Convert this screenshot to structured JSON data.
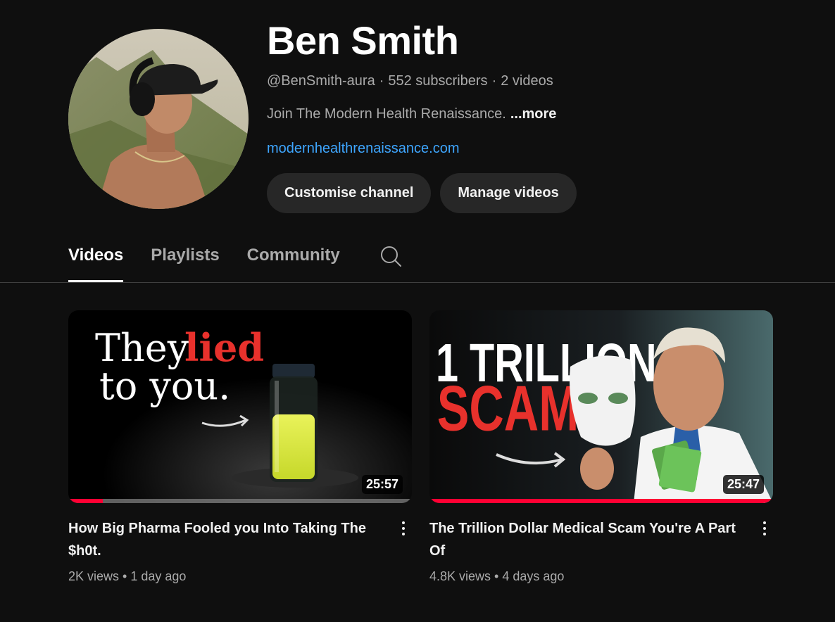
{
  "channel": {
    "name": "Ben Smith",
    "handle": "@BenSmith-aura",
    "subscribers": "552 subscribers",
    "video_count": "2 videos",
    "description": "Join The Modern Health Renaissance.",
    "more_label": "...more",
    "link": "modernhealthrenaissance.com",
    "buttons": {
      "customise": "Customise channel",
      "manage": "Manage videos"
    }
  },
  "tabs": [
    {
      "label": "Videos",
      "active": true
    },
    {
      "label": "Playlists",
      "active": false
    },
    {
      "label": "Community",
      "active": false
    }
  ],
  "tab_search_icon": "search-icon",
  "videos": [
    {
      "title": "How Big Pharma Fooled you Into Taking The $h0t.",
      "views": "2K views",
      "age": "1 day ago",
      "duration": "25:57",
      "watched_fraction": 0.1,
      "thumbnail_text": {
        "line1_a": "They",
        "line1_b": "lied",
        "line2": "to you."
      }
    },
    {
      "title": "The Trillion Dollar Medical Scam You're A Part Of",
      "views": "4.8K views",
      "age": "4 days ago",
      "duration": "25:47",
      "watched_fraction": 1.0,
      "thumbnail_text": {
        "line1": "1 TRILLION",
        "line2": "SCAM"
      }
    }
  ],
  "colors": {
    "background": "#0f0f0f",
    "link": "#3ea6ff",
    "button_bg": "#272727",
    "progress": "#ff0033",
    "thumb_accent_red": "#e8312c"
  }
}
